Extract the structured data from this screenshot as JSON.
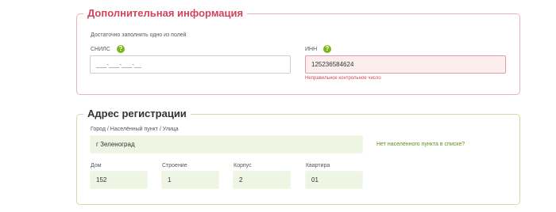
{
  "additional": {
    "title": "Дополнительная информация",
    "hint": "Достаточно заполнить одно из полей",
    "snils": {
      "label": "СНИЛС",
      "value": "___-___-___-__",
      "help_icon": "question-circle-icon"
    },
    "inn": {
      "label": "ИНН",
      "value": "125236584624",
      "help_icon": "question-circle-icon",
      "error": "Неправильное контрольное число"
    }
  },
  "registration": {
    "title": "Адрес регистрации",
    "address": {
      "label": "Город / Населённый пункт / Улица",
      "value": "г Зеленоград"
    },
    "missing_link": "Нет населенного пункта в списке?",
    "house": {
      "label": "Дом",
      "value": "152"
    },
    "building": {
      "label": "Строение",
      "value": "1"
    },
    "block": {
      "label": "Корпус",
      "value": "2"
    },
    "apartment": {
      "label": "Квартира",
      "value": "01"
    }
  },
  "colors": {
    "accent_red": "#d0445b",
    "accent_green": "#7cb518",
    "field_error_bg": "#fdeeee",
    "field_filled_bg": "#eef6e3"
  }
}
